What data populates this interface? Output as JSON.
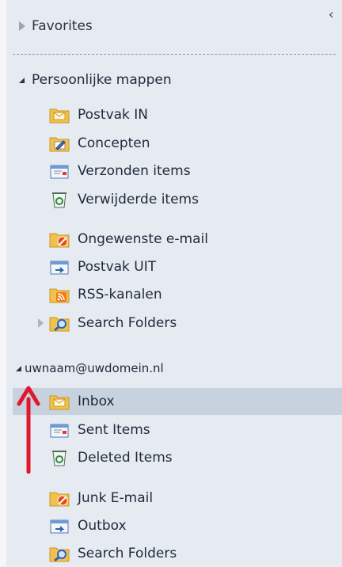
{
  "favorites": {
    "label": "Favorites",
    "collapse_glyph": "‹"
  },
  "personal": {
    "label": "Persoonlijke mappen",
    "items": [
      {
        "label": "Postvak IN",
        "icon": "inbox-folder-icon"
      },
      {
        "label": "Concepten",
        "icon": "drafts-folder-icon"
      },
      {
        "label": "Verzonden items",
        "icon": "sent-folder-icon"
      },
      {
        "label": "Verwijderde items",
        "icon": "trash-folder-icon"
      },
      {
        "label": "Ongewenste e-mail",
        "icon": "junk-folder-icon"
      },
      {
        "label": "Postvak UIT",
        "icon": "outbox-folder-icon"
      },
      {
        "label": "RSS-kanalen",
        "icon": "rss-folder-icon"
      },
      {
        "label": "Search Folders",
        "icon": "search-folder-icon"
      }
    ]
  },
  "account": {
    "label": "uwnaam@uwdomein.nl",
    "items": [
      {
        "label": "Inbox",
        "icon": "inbox-folder-icon",
        "selected": true
      },
      {
        "label": "Sent Items",
        "icon": "sent-folder-icon"
      },
      {
        "label": "Deleted Items",
        "icon": "trash-folder-icon"
      },
      {
        "label": "Junk E-mail",
        "icon": "junk-folder-icon"
      },
      {
        "label": "Outbox",
        "icon": "outbox-folder-icon"
      },
      {
        "label": "Search Folders",
        "icon": "search-folder-icon"
      }
    ]
  },
  "colors": {
    "selection": "#c8d2de",
    "arrow": "#e0182d",
    "folder": "#f3c24f"
  }
}
